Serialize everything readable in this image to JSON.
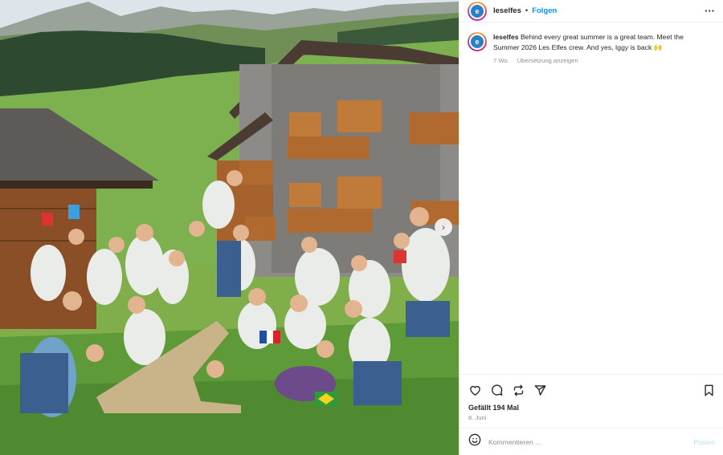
{
  "post": {
    "username": "leselfes",
    "separator": "•",
    "follow_label": "Folgen",
    "more_label": "···",
    "avatar_letter": "e",
    "caption_username": "leselfes",
    "caption_text": "Behind every great summer is a great team. Meet the Summer 2026 Les Elfes crew. And yes, Iggy is back 🙌",
    "age": "7 Wo.",
    "translate_label": "Übersetzung anzeigen",
    "likes": "Gefällt 194 Mal",
    "date": "8. Juni"
  },
  "actions": {
    "icons": [
      "heart-icon",
      "comment-icon",
      "repost-icon",
      "share-icon",
      "bookmark-icon"
    ]
  },
  "comment": {
    "placeholder": "Kommentieren ...",
    "post_label": "Posten",
    "emoji_icon": "smiley-icon"
  },
  "photo": {
    "next_arrow": "›",
    "colors": {
      "sky": "#dfe6ea",
      "grass": "#79a84a",
      "lawn": "#5f9a3a",
      "stone": "#8a8a86",
      "wood": "#a8622c",
      "forest": "#2e4a30"
    }
  }
}
